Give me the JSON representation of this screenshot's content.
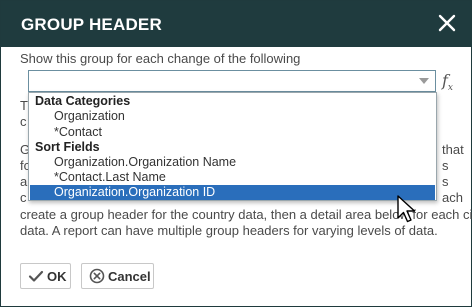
{
  "dialog": {
    "title": "GROUP HEADER",
    "prompt": "Show this group for each change of the following",
    "select_value": ""
  },
  "background_text": {
    "line1": "T",
    "line2": "c",
    "line3_left": "G",
    "line3_right": "that",
    "line4_left": "fo",
    "line4_right": "s",
    "line5_left": "a",
    "line5_right": "s",
    "line6_left": "c",
    "line6_right": "ach",
    "line7": "create a group header for the country data, then a detail area below for each city",
    "line8": "data. A report can have multiple group headers for varying levels of data."
  },
  "dropdown": {
    "groups": [
      {
        "label": "Data Categories",
        "options": [
          "Organization",
          "*Contact"
        ]
      },
      {
        "label": "Sort Fields",
        "options": [
          "Organization.Organization Name",
          "*Contact.Last Name",
          "Organization.Organization ID"
        ]
      }
    ],
    "selected": "Organization.Organization ID"
  },
  "buttons": {
    "ok": "OK",
    "cancel": "Cancel"
  },
  "icons": {
    "close": "close-icon",
    "fx": "function-icon",
    "ok": "checkmark-icon",
    "cancel": "cancel-circle-icon"
  },
  "colors": {
    "titlebar": "#1f3b3e",
    "selected_row": "#2a6ebb"
  }
}
